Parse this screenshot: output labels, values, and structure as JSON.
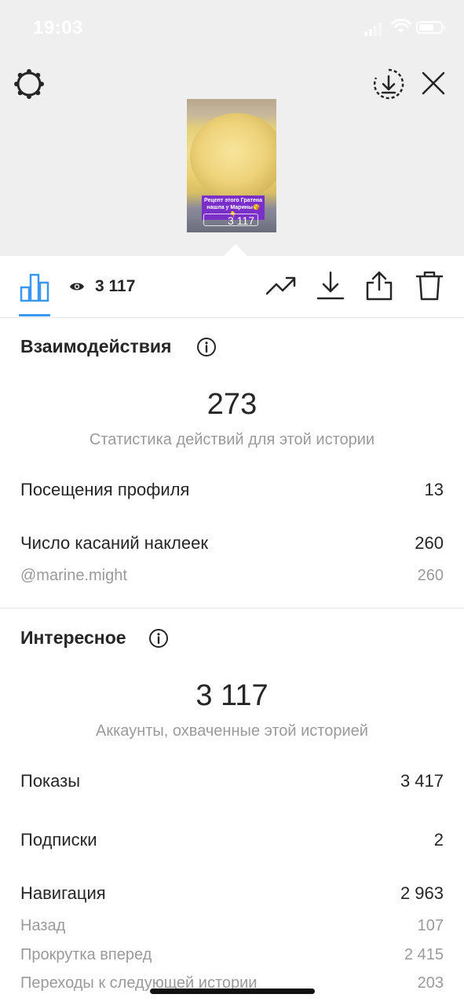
{
  "status_bar": {
    "time": "19:03",
    "battery_level": 0.7
  },
  "story_preview": {
    "caption": "Рецепт этого Гратена нашла у Марины😘 👇",
    "views_label": "3 117"
  },
  "toolbar": {
    "tab_icon": "bar-chart-icon",
    "views_icon": "eye-icon",
    "views_count": "3 117",
    "icons": [
      "trend-icon",
      "download-icon",
      "share-icon",
      "trash-icon"
    ],
    "accent_color": "#3897f0"
  },
  "interactions": {
    "title": "Взаимодействия",
    "total": "273",
    "subtitle": "Статистика действий для этой истории",
    "rows": [
      {
        "label": "Посещения профиля",
        "value": "13"
      },
      {
        "label": "Число касаний наклеек",
        "value": "260"
      }
    ],
    "sub_rows": [
      {
        "label": "@marine.might",
        "value": "260"
      }
    ]
  },
  "discovery": {
    "title": "Интересное",
    "total": "3 117",
    "subtitle": "Аккаунты, охваченные этой историей",
    "rows": [
      {
        "label": "Показы",
        "value": "3 417"
      },
      {
        "label": "Подписки",
        "value": "2"
      },
      {
        "label": "Навигация",
        "value": "2 963"
      }
    ],
    "navigation_rows": [
      {
        "label": "Назад",
        "value": "107"
      },
      {
        "label": "Прокрутка вперед",
        "value": "2 415"
      },
      {
        "label": "Переходы к следующей истории",
        "value": "203"
      }
    ]
  }
}
